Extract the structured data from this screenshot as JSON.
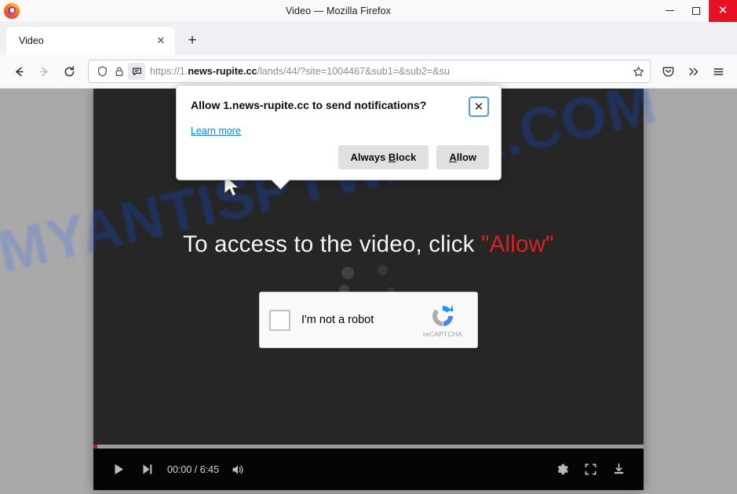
{
  "window": {
    "title": "Video — Mozilla Firefox",
    "logo_icon": "firefox-logo",
    "minimize_label": "Minimize",
    "maximize_label": "Maximize",
    "close_label": "✕",
    "close_color": "#e81123"
  },
  "tabs": {
    "items": [
      {
        "label": "Video",
        "close_label": "✕",
        "active": true
      }
    ],
    "new_tab_label": "+"
  },
  "nav": {
    "back_icon": "back-arrow-icon",
    "forward_icon": "forward-arrow-icon",
    "reload_icon": "reload-icon",
    "pocket_icon": "pocket-icon",
    "overflow_label": "»",
    "menu_icon": "hamburger-menu-icon"
  },
  "urlbar": {
    "scheme": "https://1.",
    "domain": "news-rupite.cc",
    "path": "/lands/44/?site=1004467&sub1=&sub2=&su",
    "shield_icon": "tracking-protection-shield-icon",
    "lock_icon": "padlock-icon",
    "permission_icon": "notification-permission-icon",
    "bookmark_icon": "bookmark-star-icon"
  },
  "doorhanger": {
    "title": "Allow 1.news-rupite.cc to send notifications?",
    "learn_more": "Learn more",
    "close_label": "✕",
    "block_button": {
      "pre": "Always ",
      "accel": "B",
      "post": "lock"
    },
    "allow_button": {
      "pre": "",
      "accel": "A",
      "post": "llow"
    },
    "focus_color": "#45a1e5"
  },
  "page": {
    "watermark": "MYANTISPYWARE.COM",
    "watermark_color": "#1e3566",
    "headline_pre": "To access to the video, click ",
    "headline_allow": "\"Allow\"",
    "allow_color": "#e02020",
    "cursor_icon": "mouse-pointer-icon"
  },
  "captcha": {
    "checkbox_label": "I'm not a robot",
    "brand": "reCAPTCHA",
    "brand_icon": "recaptcha-logo",
    "checked": false
  },
  "player": {
    "play_icon": "play-icon",
    "next_icon": "next-track-icon",
    "time": "00:00 / 6:45",
    "current_time": "00:00",
    "duration": "6:45",
    "volume_icon": "volume-icon",
    "settings_icon": "gear-icon",
    "fullscreen_icon": "fullscreen-icon",
    "download_icon": "download-icon",
    "progress_color": "#e0003c",
    "progress_percent": 0
  }
}
